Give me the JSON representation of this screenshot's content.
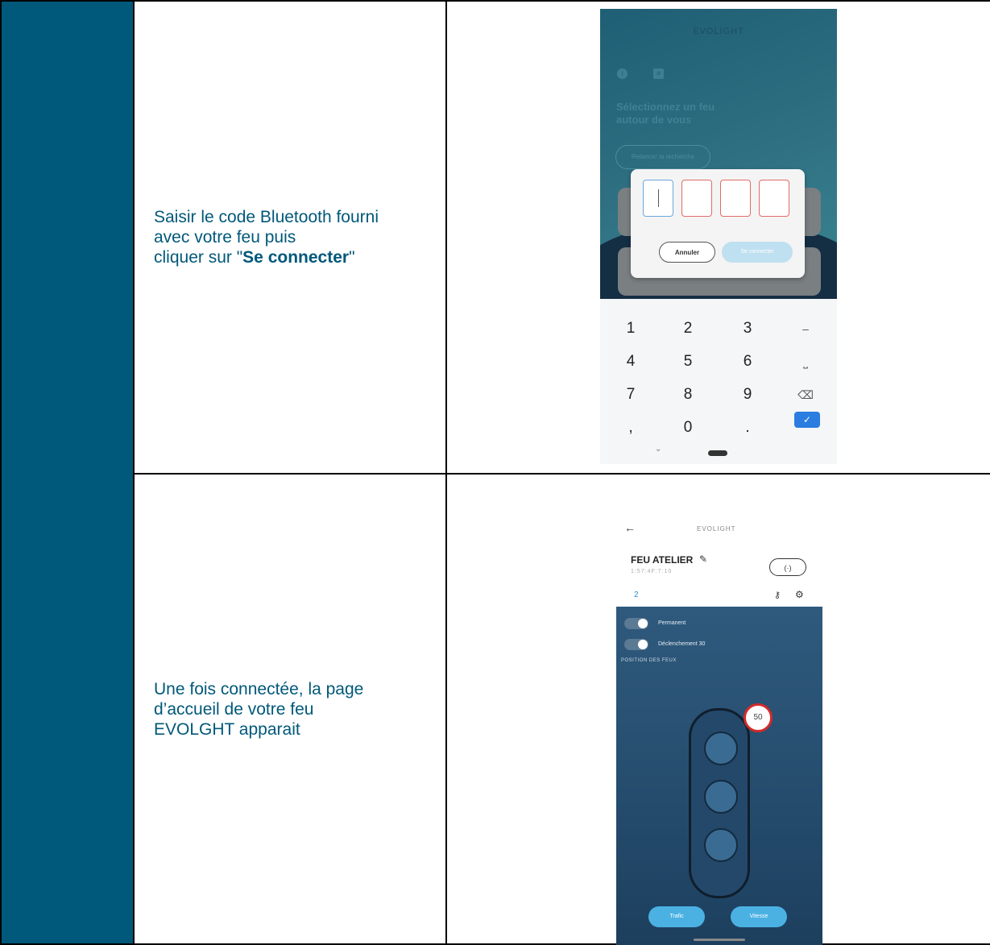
{
  "colors": {
    "accent": "#00587a",
    "dialog_error": "#e16b66",
    "dialog_active": "#6aa6db",
    "connect_button": "#bfe0f0",
    "primary_button": "#4bb1e3",
    "sign_red": "#d32b2b"
  },
  "rows": [
    {
      "text_lines": [
        "Saisir le code Bluetooth fourni",
        "avec votre feu puis"
      ],
      "text_prefix": "cliquer sur \"",
      "text_bold": "Se connecter",
      "text_suffix": "\""
    },
    {
      "text_lines": [
        "Une fois connectée, la page",
        "d’accueil de votre feu",
        "EVOLGHT apparait"
      ]
    }
  ],
  "screen1": {
    "brand": "EVOLIGHT",
    "icons": [
      "info-icon",
      "document-icon"
    ],
    "heading_line1": "Sélectionnez un feu",
    "heading_line2": "autour de vous",
    "relaunch_label": "Relancer la recherche",
    "code_boxes": 4,
    "cancel_label": "Annuler",
    "connect_label": "Se connecter",
    "keypad": [
      [
        "1",
        "2",
        "3",
        "–"
      ],
      [
        "4",
        "5",
        "6",
        "⎵"
      ],
      [
        "7",
        "8",
        "9",
        "⌫"
      ],
      [
        ",",
        "0",
        ".",
        "✓"
      ]
    ]
  },
  "screen2": {
    "back_icon": "back-arrow-icon",
    "brand": "EVOLIGHT",
    "device_name": "FEU ATELIER",
    "device_sub": "1:57:4F:7:10",
    "connect_icon": "connection-icon",
    "count_label": "2",
    "toggle_labels": [
      "Permanent",
      "Déclenchement 30"
    ],
    "section_caption": "POSITION DES FEUX",
    "speed_sign": "50",
    "buttons": [
      "Trafic",
      "Vitesse"
    ]
  }
}
